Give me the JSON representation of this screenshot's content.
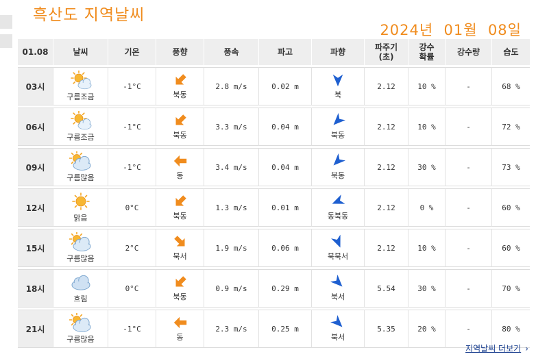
{
  "title": "흑산도 지역날씨",
  "date": "2024년  01월  08일",
  "headers": {
    "date": "01.08",
    "weather": "날씨",
    "temp": "기온",
    "wind_dir": "풍향",
    "wind_speed": "풍속",
    "wave_height": "파고",
    "wave_dir": "파향",
    "wave_period": "파주기\n(초)",
    "precip_prob": "강수\n확률",
    "precip_amount": "강수량",
    "humidity": "습도"
  },
  "rows": [
    {
      "time": "03시",
      "sky": "구름조금",
      "sky_icon": "partly-cloudy-icon",
      "temp": "-1°C",
      "wind_dir": "북동",
      "wind_speed": "2.8 m/s",
      "wave_height": "0.02 m",
      "wave_dir": "북",
      "wave_period": "2.12",
      "precip_prob": "10 %",
      "precip_amount": "-",
      "humidity": "68 %"
    },
    {
      "time": "06시",
      "sky": "구름조금",
      "sky_icon": "partly-cloudy-icon",
      "temp": "-1°C",
      "wind_dir": "북동",
      "wind_speed": "3.3 m/s",
      "wave_height": "0.04 m",
      "wave_dir": "북동",
      "wave_period": "2.12",
      "precip_prob": "10 %",
      "precip_amount": "-",
      "humidity": "72 %"
    },
    {
      "time": "09시",
      "sky": "구름많음",
      "sky_icon": "mostly-cloudy-icon",
      "temp": "-1°C",
      "wind_dir": "동",
      "wind_speed": "3.4 m/s",
      "wave_height": "0.04 m",
      "wave_dir": "북동",
      "wave_period": "2.12",
      "precip_prob": "30 %",
      "precip_amount": "-",
      "humidity": "73 %"
    },
    {
      "time": "12시",
      "sky": "맑음",
      "sky_icon": "sunny-icon",
      "temp": "0°C",
      "wind_dir": "북동",
      "wind_speed": "1.3 m/s",
      "wave_height": "0.01 m",
      "wave_dir": "동북동",
      "wave_period": "2.12",
      "precip_prob": "0 %",
      "precip_amount": "-",
      "humidity": "60 %"
    },
    {
      "time": "15시",
      "sky": "구름많음",
      "sky_icon": "mostly-cloudy-icon",
      "temp": "2°C",
      "wind_dir": "북서",
      "wind_speed": "1.9 m/s",
      "wave_height": "0.06 m",
      "wave_dir": "북북서",
      "wave_period": "2.12",
      "precip_prob": "10 %",
      "precip_amount": "-",
      "humidity": "60 %"
    },
    {
      "time": "18시",
      "sky": "흐림",
      "sky_icon": "cloudy-icon",
      "temp": "0°C",
      "wind_dir": "북동",
      "wind_speed": "0.9 m/s",
      "wave_height": "0.29 m",
      "wave_dir": "북서",
      "wave_period": "5.54",
      "precip_prob": "30 %",
      "precip_amount": "-",
      "humidity": "70 %"
    },
    {
      "time": "21시",
      "sky": "구름많음",
      "sky_icon": "mostly-cloudy-icon",
      "temp": "-1°C",
      "wind_dir": "동",
      "wind_speed": "2.3 m/s",
      "wave_height": "0.25 m",
      "wave_dir": "북서",
      "wave_period": "5.35",
      "precip_prob": "20 %",
      "precip_amount": "-",
      "humidity": "80 %"
    }
  ],
  "more_link": "지역날씨 더보기",
  "colors": {
    "accent": "#f08c1e",
    "wind_arrow": "#f08c1e",
    "wave_arrow": "#1e5fd0",
    "link": "#1a3f8f"
  }
}
